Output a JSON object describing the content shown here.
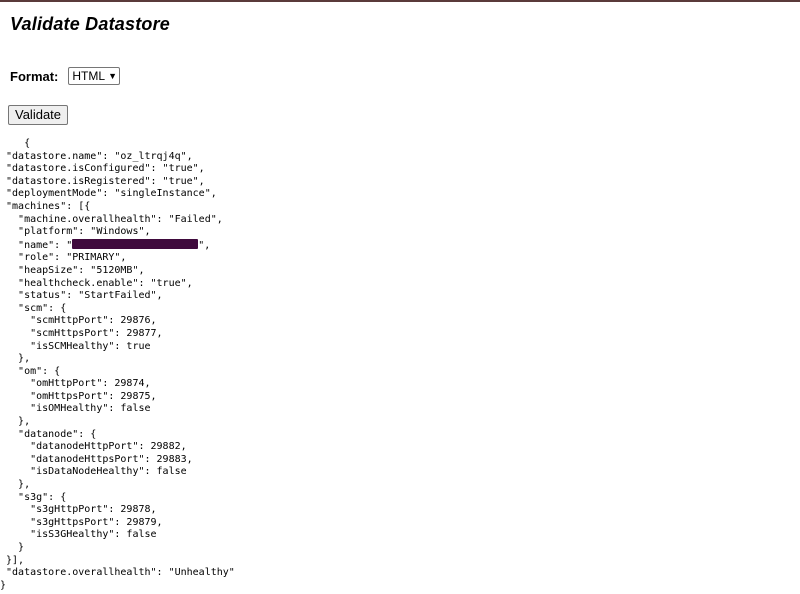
{
  "page": {
    "title": "Validate Datastore"
  },
  "form": {
    "format_label": "Format:",
    "format_selected": "HTML",
    "validate_label": "Validate"
  },
  "output_lines": [
    "    {",
    " \"datastore.name\": \"oz_ltrqj4q\",",
    " \"datastore.isConfigured\": \"true\",",
    " \"datastore.isRegistered\": \"true\",",
    " \"deploymentMode\": \"singleInstance\",",
    " \"machines\": [{",
    "   \"machine.overallhealth\": \"Failed\",",
    "   \"platform\": \"Windows\",",
    "   \"name\": \"",
    "   \"role\": \"PRIMARY\",",
    "   \"heapSize\": \"5120MB\",",
    "   \"healthcheck.enable\": \"true\",",
    "   \"status\": \"StartFailed\",",
    "   \"scm\": {",
    "     \"scmHttpPort\": 29876,",
    "     \"scmHttpsPort\": 29877,",
    "     \"isSCMHealthy\": true",
    "   },",
    "   \"om\": {",
    "     \"omHttpPort\": 29874,",
    "     \"omHttpsPort\": 29875,",
    "     \"isOMHealthy\": false",
    "   },",
    "   \"datanode\": {",
    "     \"datanodeHttpPort\": 29882,",
    "     \"datanodeHttpsPort\": 29883,",
    "     \"isDataNodeHealthy\": false",
    "   },",
    "   \"s3g\": {",
    "     \"s3gHttpPort\": 29878,",
    "     \"s3gHttpsPort\": 29879,",
    "     \"isS3GHealthy\": false",
    "   }",
    " }],",
    " \"datastore.overallhealth\": \"Unhealthy\"",
    "}"
  ],
  "redacted_name_suffix": "\",",
  "colors": {
    "redaction": "#3f0a3d",
    "top_rule": "#5a3a3a"
  }
}
